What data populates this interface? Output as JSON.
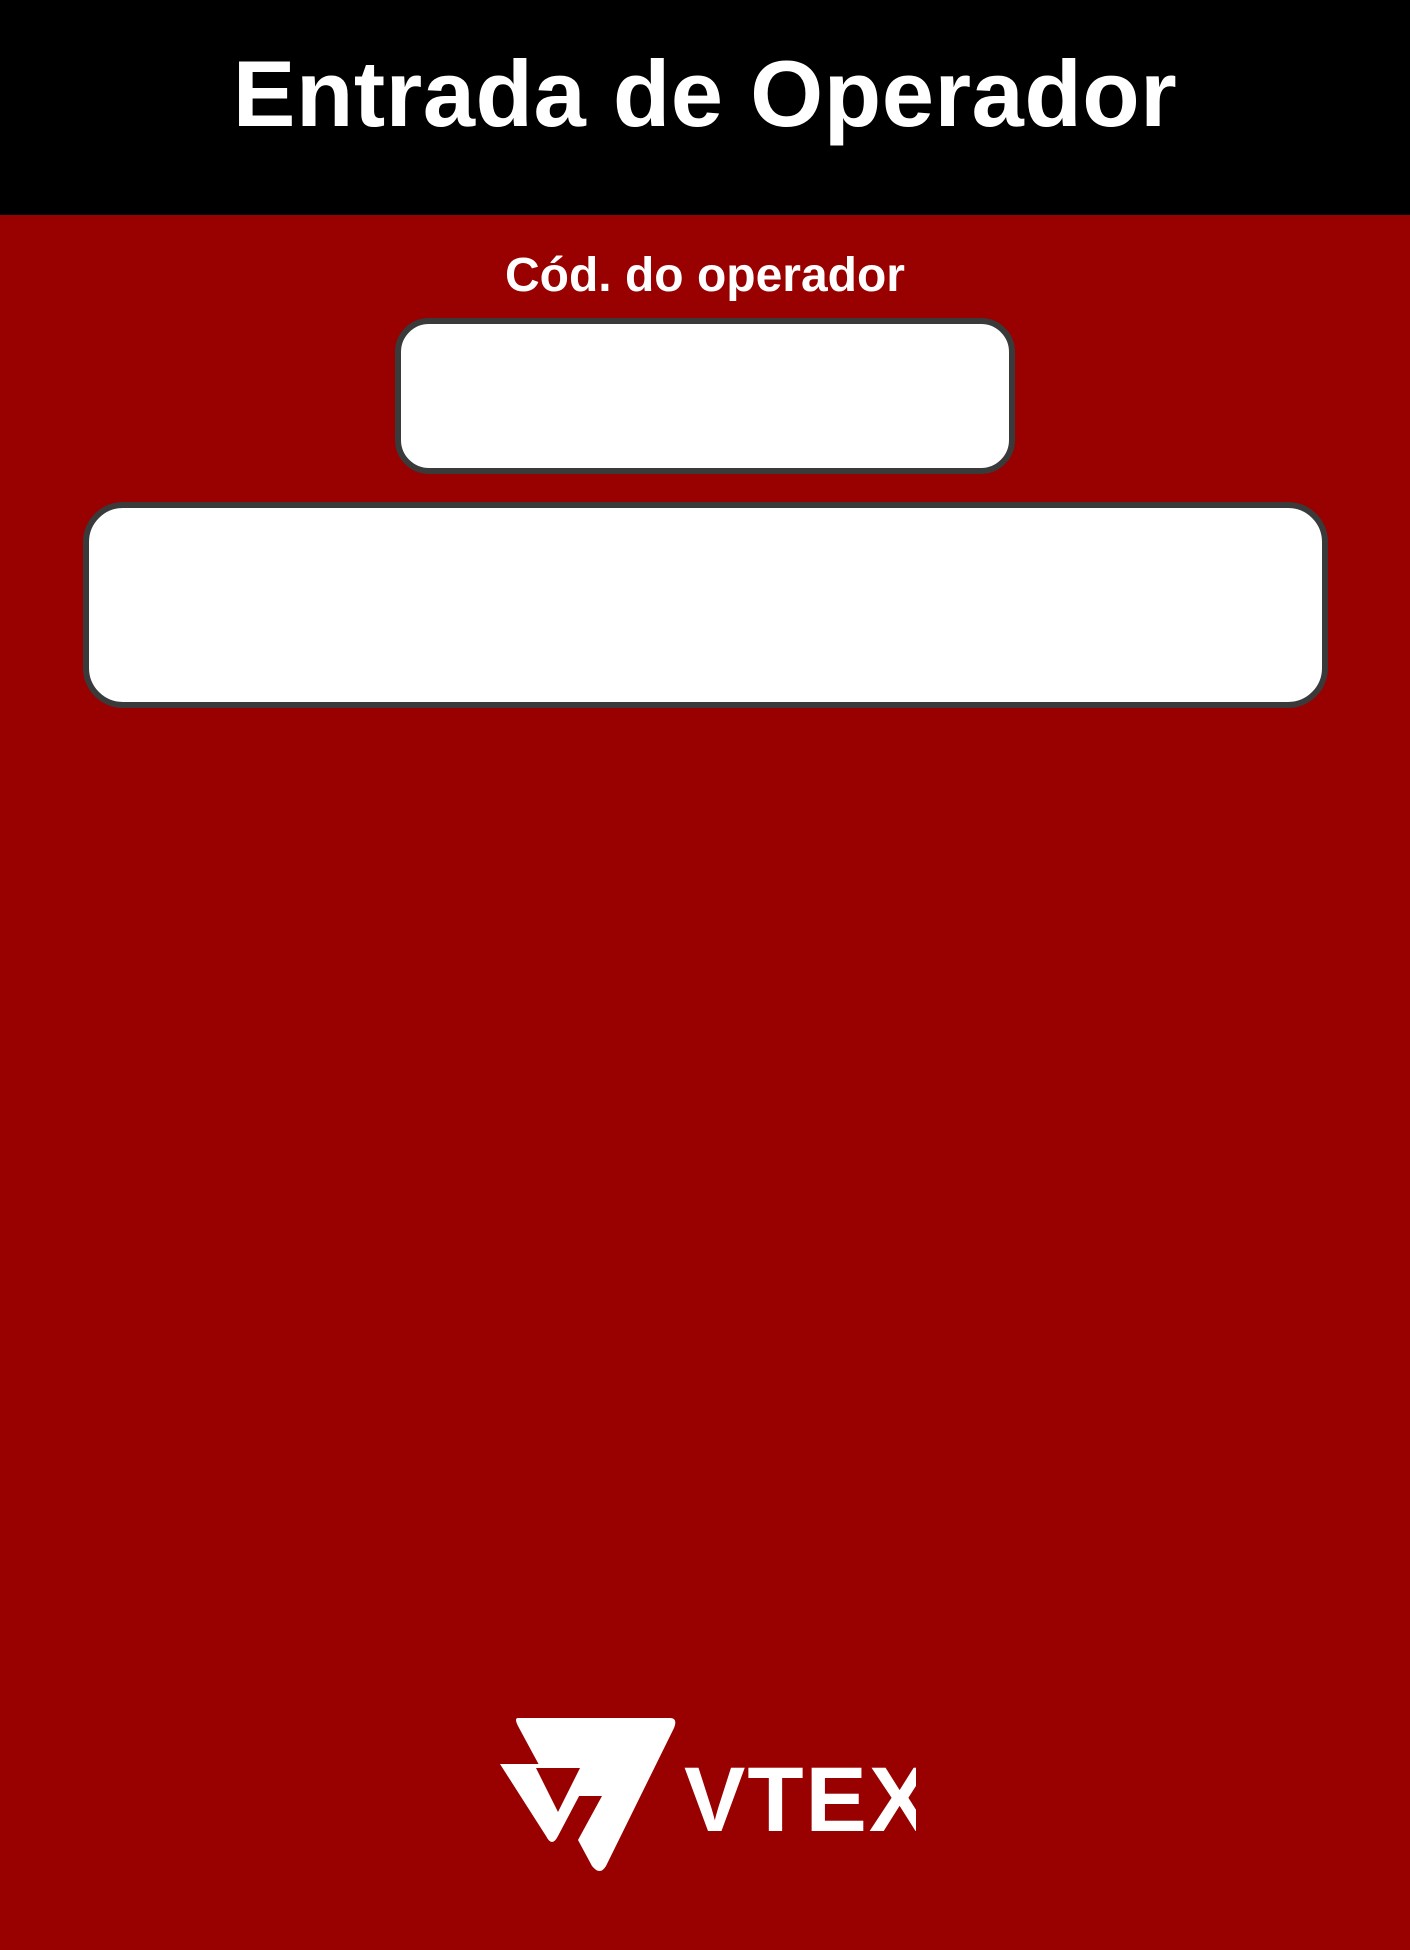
{
  "header": {
    "title": "Entrada de Operador"
  },
  "form": {
    "operator_code_label": "Cód. do operador",
    "operator_code_value": "",
    "message": ""
  },
  "brand": {
    "logo_text": "VTEX",
    "logo_color": "#ffffff"
  },
  "colors": {
    "background": "#990000",
    "header_background": "#000000",
    "field_border": "#3a3a3a"
  },
  "icons": {
    "logo": "vtex-logo-icon"
  }
}
